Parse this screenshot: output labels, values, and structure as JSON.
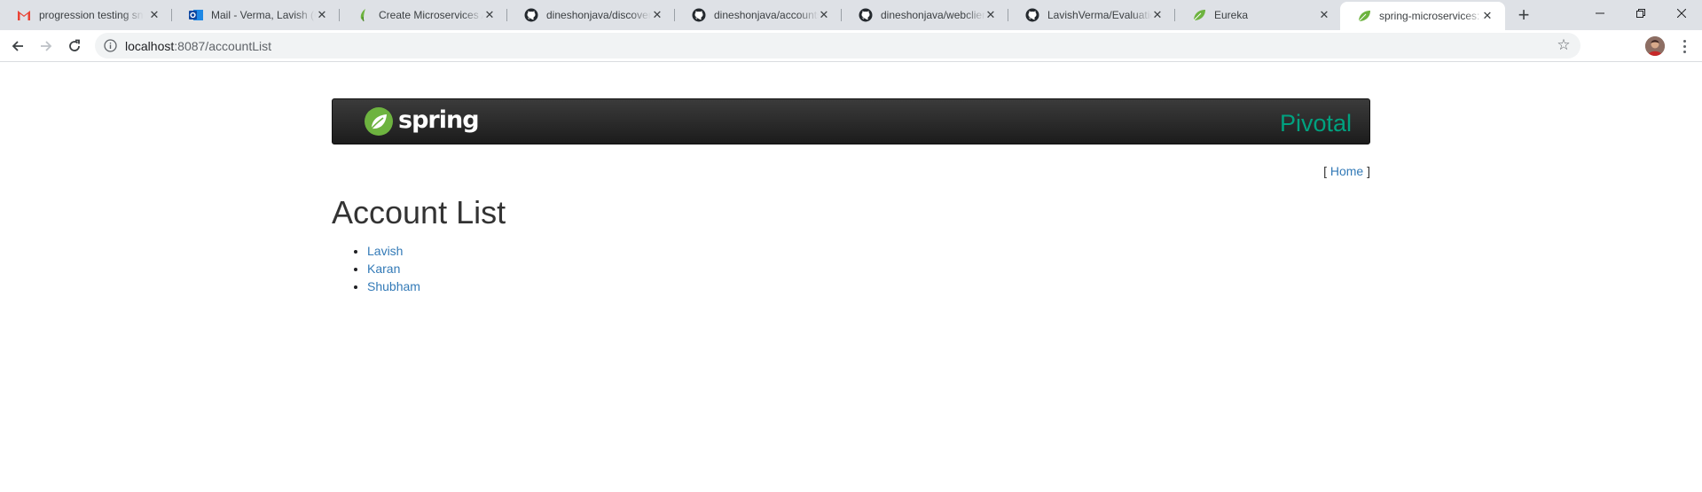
{
  "browser": {
    "tabs": [
      {
        "title": "progression testing sna",
        "icon": "gmail-icon"
      },
      {
        "title": "Mail - Verma, Lavish (C",
        "icon": "outlook-icon"
      },
      {
        "title": "Create Microservices A",
        "icon": "spring-leaf-icon"
      },
      {
        "title": "dineshonjava/discovery",
        "icon": "github-icon"
      },
      {
        "title": "dineshonjava/accounts",
        "icon": "github-icon"
      },
      {
        "title": "dineshonjava/webclient",
        "icon": "github-icon"
      },
      {
        "title": "LavishVerma/Evaluation",
        "icon": "github-icon"
      },
      {
        "title": "Eureka",
        "icon": "spring-leaf-icon"
      },
      {
        "title": "spring-microservices: A",
        "icon": "spring-leaf-icon",
        "active": true
      }
    ],
    "url_host": "localhost",
    "url_path": ":8087/accountList",
    "colors": {
      "tabstrip": "#dee1e6",
      "active_tab": "#ffffff"
    }
  },
  "page": {
    "banner": {
      "brand": "spring",
      "partner": "Pivotal",
      "partner_color": "#00a17f"
    },
    "home_link": "Home",
    "title": "Account List",
    "accounts": [
      "Lavish",
      "Karan",
      "Shubham"
    ],
    "link_color": "#337ab7"
  }
}
